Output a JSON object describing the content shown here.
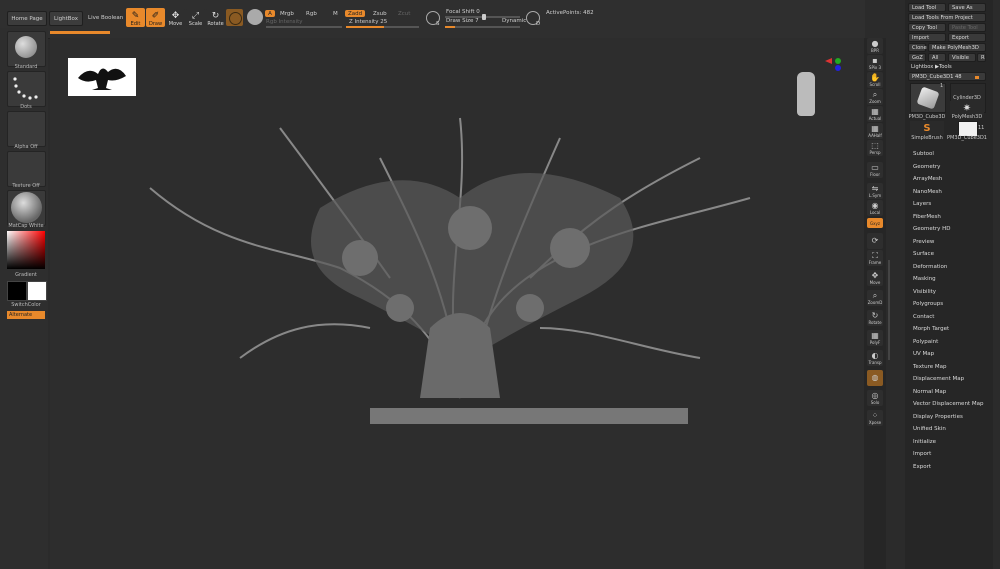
{
  "top_bar": {
    "home_page": "Home Page",
    "lightbox": "LightBox",
    "live_boolean": "Live Boolean",
    "tools": [
      {
        "label": "Edit",
        "icon": "edit-icon",
        "active": true
      },
      {
        "label": "Draw",
        "icon": "draw-icon",
        "active": true
      },
      {
        "label": "Move",
        "icon": "move-icon",
        "active": false
      },
      {
        "label": "Scale",
        "icon": "scale-icon",
        "active": false
      },
      {
        "label": "Rotate",
        "icon": "rotate-icon",
        "active": false
      }
    ],
    "a_button": "A",
    "mrgb": "Mrgb",
    "rgb": "Rgb",
    "m": "M",
    "zadd": "Zadd",
    "zsub": "Zsub",
    "zcut": "Zcut",
    "rgb_intensity": "Rgb Intensity",
    "z_intensity": {
      "label": "Z Intensity",
      "value": "25"
    },
    "focal_shift": {
      "label": "Focal Shift",
      "value": "0"
    },
    "draw_size": {
      "label": "Draw Size",
      "value": "7"
    },
    "dynamic": "Dynamic",
    "active_points": "ActivePoints: 482"
  },
  "left_shelf": {
    "brush": "Standard",
    "stroke": "Dots",
    "alpha": "Alpha Off",
    "texture": "Texture Off",
    "material": "MatCap White",
    "gradient": "Gradient",
    "switch_color": "SwitchColor",
    "alternate": "Alternate"
  },
  "right_shelf": [
    {
      "label": "BPR",
      "icon": "bpr-icon"
    },
    {
      "label": "SPix 3",
      "icon": "spix-icon"
    },
    {
      "label": "Scroll",
      "icon": "scroll-icon"
    },
    {
      "label": "Zoom",
      "icon": "zoom-icon"
    },
    {
      "label": "Actual",
      "icon": "actual-icon"
    },
    {
      "label": "AAHalf",
      "icon": "aahalf-icon"
    },
    {
      "label": "Persp",
      "icon": "persp-icon"
    },
    {
      "label": "Floor",
      "icon": "floor-icon"
    },
    {
      "label": "L.Sym",
      "icon": "lsym-icon"
    },
    {
      "label": "Local",
      "icon": "local-icon"
    },
    {
      "label": "Gxyz",
      "icon": "xyz-icon"
    },
    {
      "label": "Frame",
      "icon": "frame-icon"
    },
    {
      "label": "Move",
      "icon": "move-icon"
    },
    {
      "label": "ZoomD",
      "icon": "zoom3d-icon"
    },
    {
      "label": "Rotate",
      "icon": "rotate-icon"
    },
    {
      "label": "PolyF",
      "icon": "polyframe-icon"
    },
    {
      "label": "Transp",
      "icon": "transp-icon"
    },
    {
      "label": "",
      "icon": "ghost-icon"
    },
    {
      "label": "Solo",
      "icon": "solo-icon"
    },
    {
      "label": "Xpose",
      "icon": "xpose-icon"
    }
  ],
  "tool_panel": {
    "load_tool": "Load Tool",
    "save_as": "Save As",
    "load_tools_from_project": "Load Tools From Project",
    "copy_tool": "Copy Tool",
    "paste_tool": "Paste Tool",
    "import": "Import",
    "export": "Export",
    "clone": "Clone",
    "make_polymesh": "Make PolyMesh3D",
    "goz": "GoZ",
    "all": "All",
    "visible": "Visible",
    "r": "R",
    "lightbox_tools": "Lightbox ▶Tools",
    "current_tool": "PM3D_Cube3D1",
    "current_value": "48",
    "thumbnails": [
      {
        "name": "PM3D_Cube3D",
        "badge": "1"
      },
      {
        "name": "Cylinder3D",
        "badge": ""
      },
      {
        "name": "",
        "badge": ""
      },
      {
        "name": "PolyMesh3D",
        "badge": ""
      },
      {
        "name": "SimpleBrush",
        "badge": ""
      },
      {
        "name": "PM3D_Cube3D1",
        "badge": "11"
      }
    ],
    "menu": [
      "Subtool",
      "Geometry",
      "ArrayMesh",
      "NanoMesh",
      "Layers",
      "FiberMesh",
      "Geometry HD",
      "Preview",
      "Surface",
      "Deformation",
      "Masking",
      "Visibility",
      "Polygroups",
      "Contact",
      "Morph Target",
      "Polypaint",
      "UV Map",
      "Texture Map",
      "Displacement Map",
      "Normal Map",
      "Vector Displacement Map",
      "Display Properties",
      "Unified Skin",
      "Initialize",
      "Import",
      "Export"
    ]
  },
  "colors": {
    "accent": "#e8892b",
    "background": "#2b2b2b",
    "panel": "#262626"
  }
}
